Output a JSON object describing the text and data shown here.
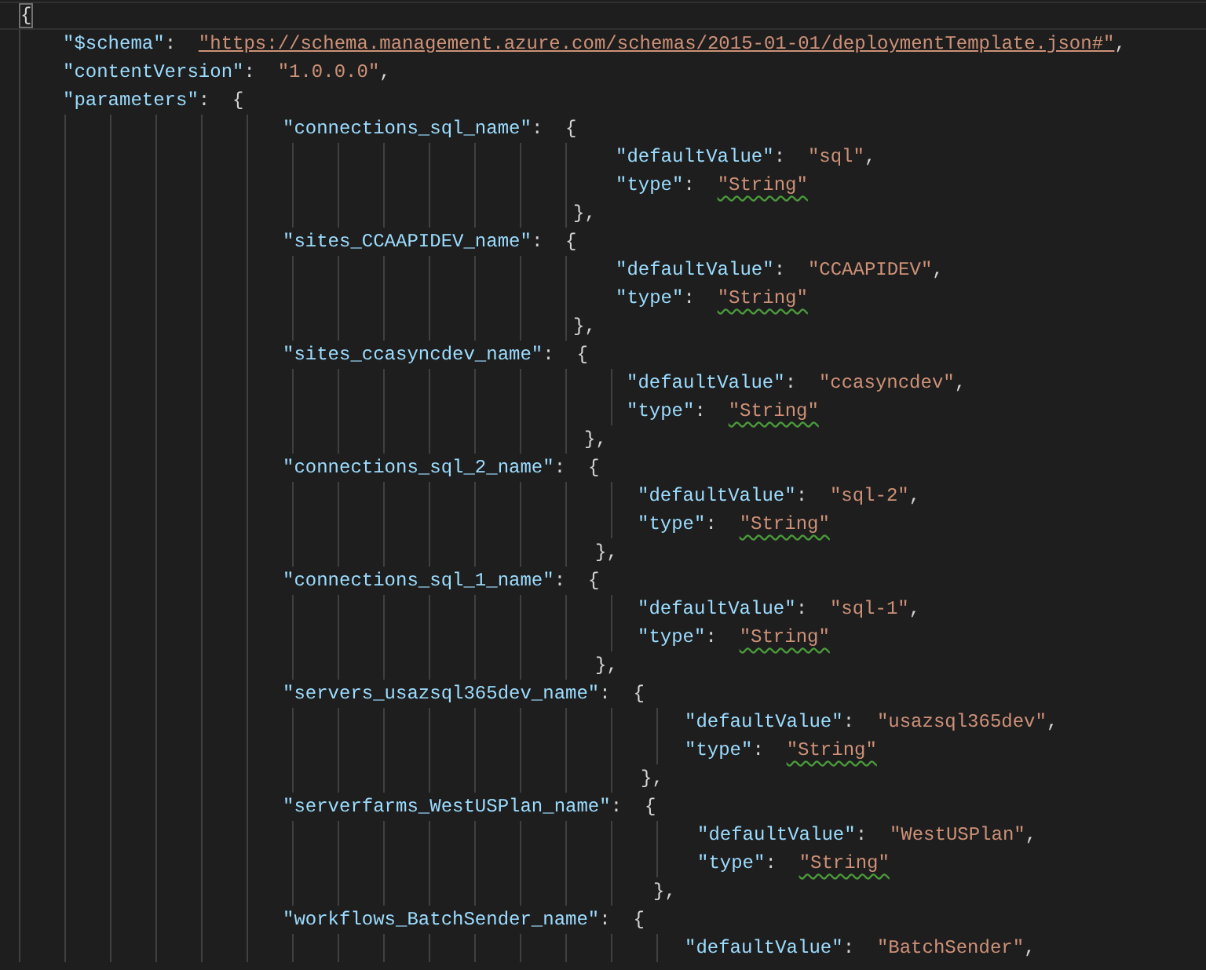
{
  "editor": {
    "open_brace": "{",
    "properties": [
      {
        "key": "\"$schema\"",
        "colon": ":",
        "value": "\"https://schema.management.azure.com/schemas/2015-01-01/deploymentTemplate.json#\"",
        "comma": ",",
        "link": true
      },
      {
        "key": "\"contentVersion\"",
        "colon": ":",
        "value": "\"1.0.0.0\"",
        "comma": ",",
        "link": false
      }
    ],
    "parameters": {
      "key": "\"parameters\"",
      "colon": ":",
      "brace": "{",
      "entries": [
        {
          "key": "\"connections_sql_name\"",
          "colon": ":",
          "brace": "{",
          "props": [
            {
              "key": "\"defaultValue\"",
              "colon": ":",
              "value": "\"sql\"",
              "comma": ",",
              "warning": false
            },
            {
              "key": "\"type\"",
              "colon": ":",
              "value": "\"String\"",
              "warning": true
            }
          ],
          "close": "},"
        },
        {
          "key": "\"sites_CCAAPIDEV_name\"",
          "colon": ":",
          "brace": "{",
          "props": [
            {
              "key": "\"defaultValue\"",
              "colon": ":",
              "value": "\"CCAAPIDEV\"",
              "comma": ",",
              "warning": false
            },
            {
              "key": "\"type\"",
              "colon": ":",
              "value": "\"String\"",
              "warning": true
            }
          ],
          "close": "},"
        },
        {
          "key": "\"sites_ccasyncdev_name\"",
          "colon": ":",
          "brace": "{",
          "props": [
            {
              "key": "\"defaultValue\"",
              "colon": ":",
              "value": "\"ccasyncdev\"",
              "comma": ",",
              "warning": false
            },
            {
              "key": "\"type\"",
              "colon": ":",
              "value": "\"String\"",
              "warning": true
            }
          ],
          "close": "},"
        },
        {
          "key": "\"connections_sql_2_name\"",
          "colon": ":",
          "brace": "{",
          "props": [
            {
              "key": "\"defaultValue\"",
              "colon": ":",
              "value": "\"sql-2\"",
              "comma": ",",
              "warning": false
            },
            {
              "key": "\"type\"",
              "colon": ":",
              "value": "\"String\"",
              "warning": true
            }
          ],
          "close": "},"
        },
        {
          "key": "\"connections_sql_1_name\"",
          "colon": ":",
          "brace": "{",
          "props": [
            {
              "key": "\"defaultValue\"",
              "colon": ":",
              "value": "\"sql-1\"",
              "comma": ",",
              "warning": false
            },
            {
              "key": "\"type\"",
              "colon": ":",
              "value": "\"String\"",
              "warning": true
            }
          ],
          "close": "},"
        },
        {
          "key": "\"servers_usazsql365dev_name\"",
          "colon": ":",
          "brace": "{",
          "props": [
            {
              "key": "\"defaultValue\"",
              "colon": ":",
              "value": "\"usazsql365dev\"",
              "comma": ",",
              "warning": false
            },
            {
              "key": "\"type\"",
              "colon": ":",
              "value": "\"String\"",
              "warning": true
            }
          ],
          "close": "},"
        },
        {
          "key": "\"serverfarms_WestUSPlan_name\"",
          "colon": ":",
          "brace": "{",
          "props": [
            {
              "key": "\"defaultValue\"",
              "colon": ":",
              "value": "\"WestUSPlan\"",
              "comma": ",",
              "warning": false
            },
            {
              "key": "\"type\"",
              "colon": ":",
              "value": "\"String\"",
              "warning": true
            }
          ],
          "close": "},"
        },
        {
          "key": "\"workflows_BatchSender_name\"",
          "colon": ":",
          "brace": "{",
          "props": [
            {
              "key": "\"defaultValue\"",
              "colon": ":",
              "value": "\"BatchSender\"",
              "comma": ",",
              "warning": false
            }
          ]
        }
      ]
    }
  }
}
